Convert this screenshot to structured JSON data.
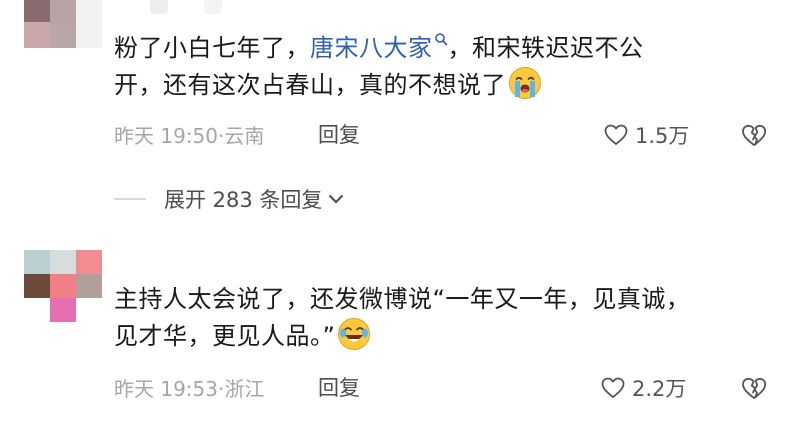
{
  "comments": [
    {
      "text_before": "粉了小白七年了，",
      "mention": "唐宋八大家",
      "text_after": "，和宋轶迟迟不公",
      "line2": "开，还有这次占春山，真的不想说了",
      "time": "昨天 19:50·云南",
      "reply_label": "回复",
      "likes": "1.5万",
      "emoji_icon": "crying-face-icon",
      "avatar_colors": [
        "#8a6b70",
        "#b8a3a6",
        "#f2f2f2",
        "#c9a7a9",
        "#b9a6a6",
        "#f3f1f2"
      ]
    },
    {
      "line1": "主持人太会说了，还发微博说“一年又一年，见真诚，",
      "line2": "见才华，更见人品。”",
      "time": "昨天 19:53·浙江",
      "reply_label": "回复",
      "likes": "2.2万",
      "emoji_icon": "tears-of-joy-icon",
      "avatar_colors": [
        "#bcd0d4",
        "#d7dcdc",
        "#f08c92",
        "#6d4a3a",
        "#f07f86",
        "#b09f9b",
        "#ffffff",
        "#e66fb4",
        "#ffffff"
      ]
    }
  ],
  "expand_replies_label": "展开 283 条回复",
  "colors": {
    "mention": "#2f5fb3",
    "meta": "#a6a6a6",
    "text": "#1a1a1a"
  }
}
